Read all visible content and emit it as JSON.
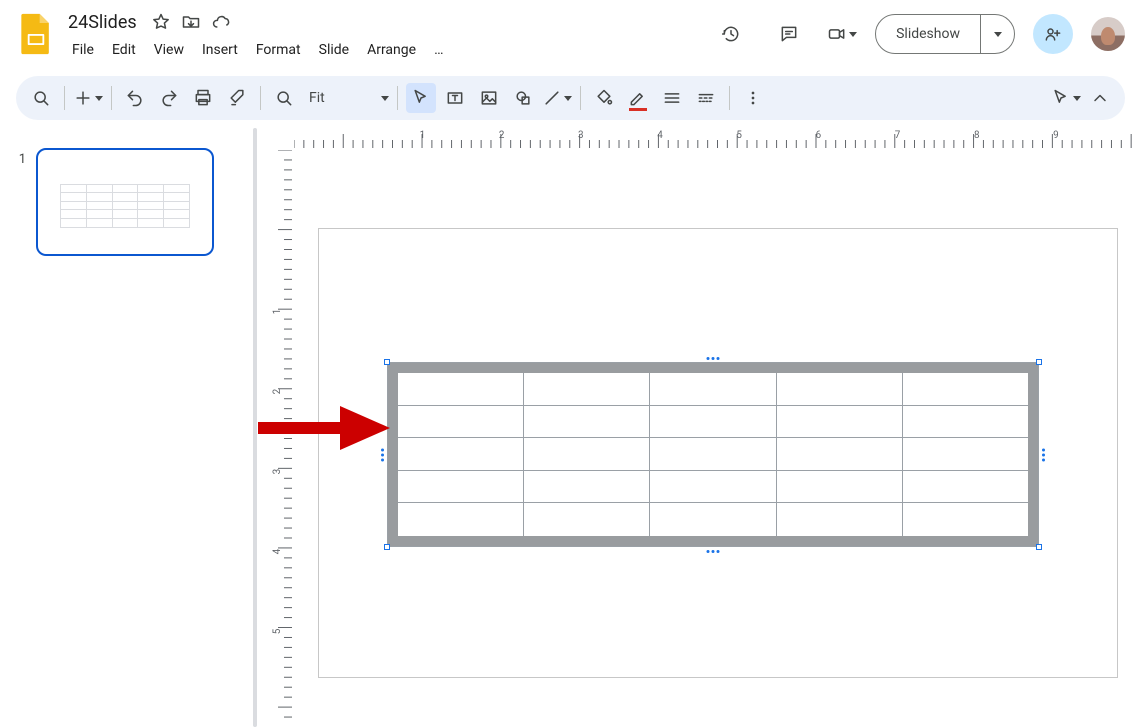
{
  "doc": {
    "title": "24Slides"
  },
  "menu": {
    "file": "File",
    "edit": "Edit",
    "view": "View",
    "insert": "Insert",
    "format": "Format",
    "slide": "Slide",
    "arrange": "Arrange",
    "overflow": "…"
  },
  "actions": {
    "slideshow": "Slideshow"
  },
  "toolbar": {
    "zoom_label": "Fit"
  },
  "filmstrip": {
    "slide_number": "1"
  },
  "ruler": {
    "h_labels": [
      "1",
      "2",
      "3",
      "4",
      "5",
      "6",
      "7",
      "8",
      "9"
    ],
    "v_labels": [
      "1",
      "2",
      "3",
      "4",
      "5"
    ]
  },
  "canvas": {
    "table": {
      "rows": 5,
      "cols": 5
    }
  }
}
